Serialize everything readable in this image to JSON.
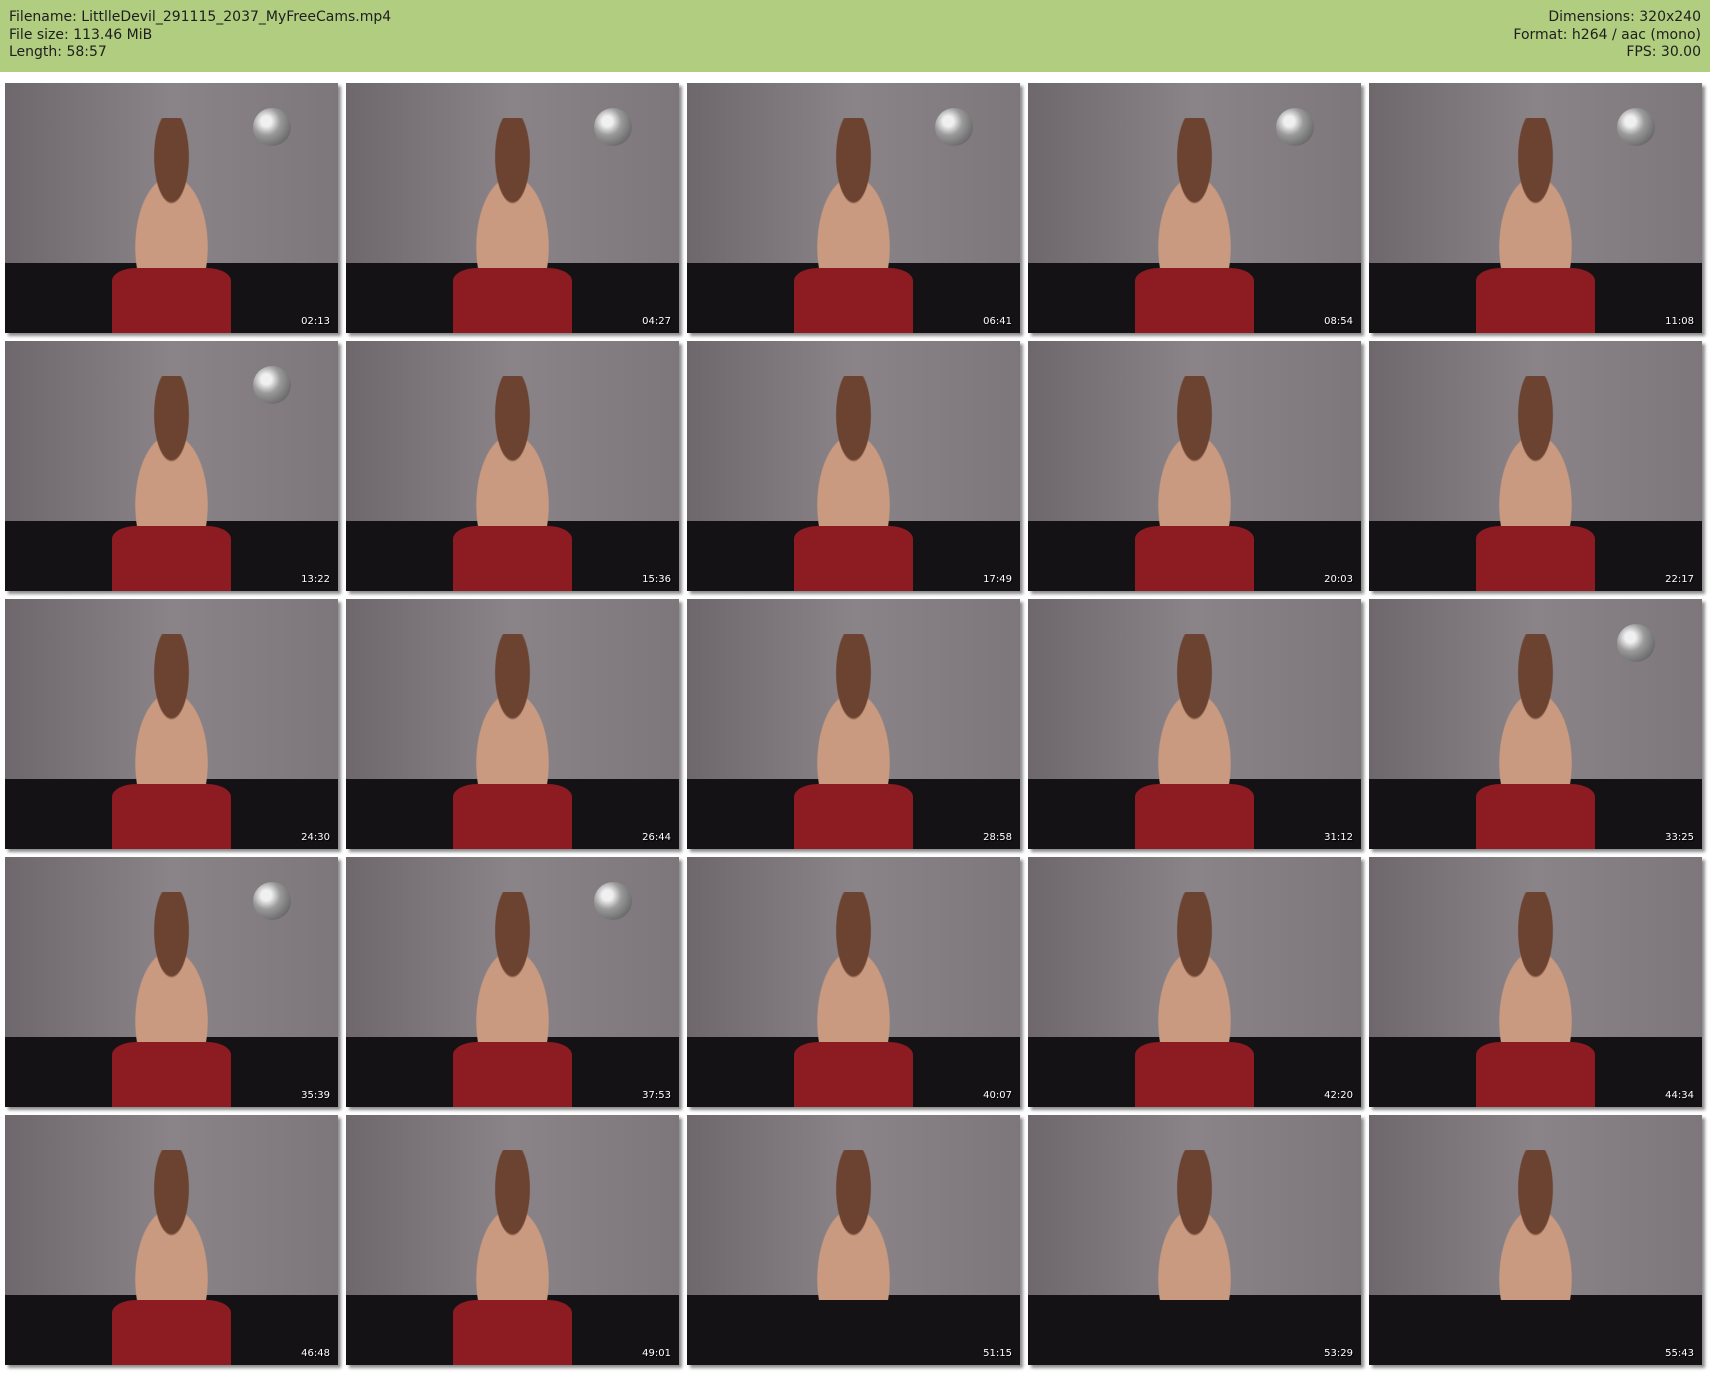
{
  "header": {
    "left": [
      "Filename: LittlleDevil_291115_2037_MyFreeCams.mp4",
      "File size: 113.46 MiB",
      "Length: 58:57"
    ],
    "right": [
      "Dimensions: 320x240",
      "Format: h264 / aac (mono)",
      "FPS: 30.00"
    ],
    "bg_color": "#b1cd80"
  },
  "thumbnails": [
    {
      "time": "02:13",
      "top": "red",
      "ball": true
    },
    {
      "time": "04:27",
      "top": "red",
      "ball": true
    },
    {
      "time": "06:41",
      "top": "red",
      "ball": true
    },
    {
      "time": "08:54",
      "top": "red",
      "ball": true
    },
    {
      "time": "11:08",
      "top": "red",
      "ball": true
    },
    {
      "time": "13:22",
      "top": "red",
      "ball": true
    },
    {
      "time": "15:36",
      "top": "red",
      "ball": false
    },
    {
      "time": "17:49",
      "top": "red",
      "ball": false
    },
    {
      "time": "20:03",
      "top": "red",
      "ball": false
    },
    {
      "time": "22:17",
      "top": "red",
      "ball": false
    },
    {
      "time": "24:30",
      "top": "red",
      "ball": false
    },
    {
      "time": "26:44",
      "top": "red",
      "ball": false
    },
    {
      "time": "28:58",
      "top": "red",
      "ball": false
    },
    {
      "time": "31:12",
      "top": "red",
      "ball": false
    },
    {
      "time": "33:25",
      "top": "red",
      "ball": true
    },
    {
      "time": "35:39",
      "top": "red",
      "ball": true
    },
    {
      "time": "37:53",
      "top": "red",
      "ball": true
    },
    {
      "time": "40:07",
      "top": "red",
      "ball": false
    },
    {
      "time": "42:20",
      "top": "red",
      "ball": false
    },
    {
      "time": "44:34",
      "top": "red",
      "ball": false
    },
    {
      "time": "46:48",
      "top": "red",
      "ball": false
    },
    {
      "time": "49:01",
      "top": "red",
      "ball": false
    },
    {
      "time": "51:15",
      "top": "black",
      "ball": false
    },
    {
      "time": "53:29",
      "top": "black",
      "ball": false
    },
    {
      "time": "55:43",
      "top": "black",
      "ball": false
    }
  ]
}
